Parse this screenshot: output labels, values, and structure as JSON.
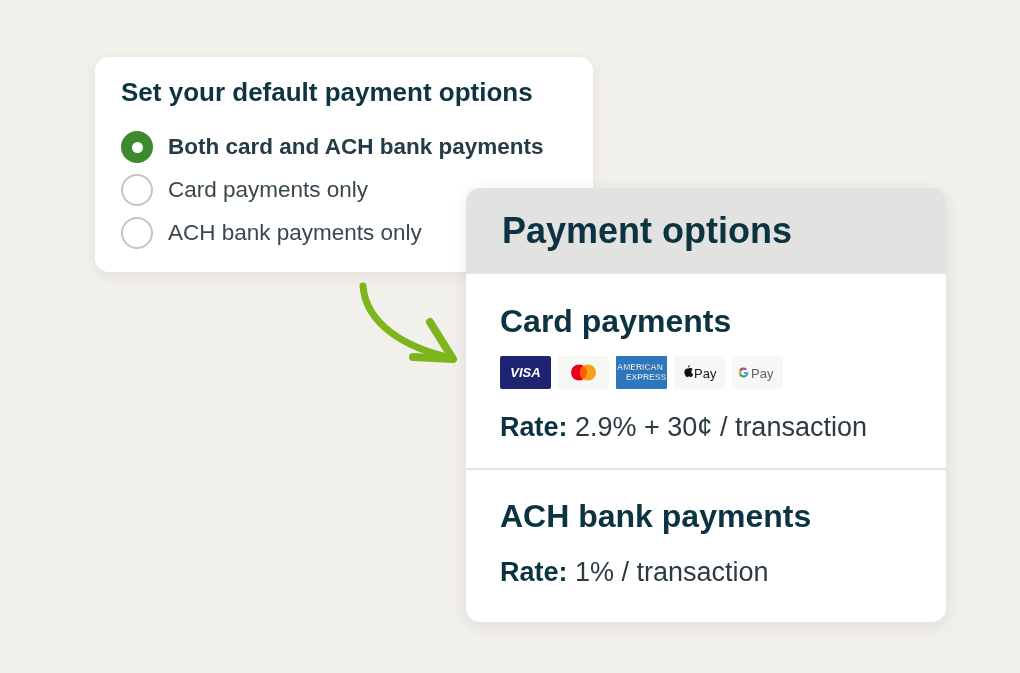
{
  "settings_card": {
    "title": "Set your default payment options",
    "options": [
      {
        "label": "Both card and ACH bank payments",
        "selected": true
      },
      {
        "label": "Card payments only",
        "selected": false
      },
      {
        "label": "ACH bank payments only",
        "selected": false
      }
    ]
  },
  "payment_options_card": {
    "title": "Payment options",
    "sections": [
      {
        "title": "Card payments",
        "logos": [
          {
            "kind": "visa",
            "lines": [
              "VISA"
            ]
          },
          {
            "kind": "mastercard"
          },
          {
            "kind": "amex",
            "lines": [
              "AMERICAN",
              "EXPRESS"
            ]
          },
          {
            "kind": "apple_pay",
            "lines": [
              "Pay"
            ]
          },
          {
            "kind": "google_pay",
            "lines": [
              "Pay"
            ]
          }
        ],
        "rate": "**Rate:** 2.9% + 30¢ / transaction"
      },
      {
        "title": "ACH bank payments",
        "rate": "**Rate:** 1% / transaction"
      }
    ]
  }
}
